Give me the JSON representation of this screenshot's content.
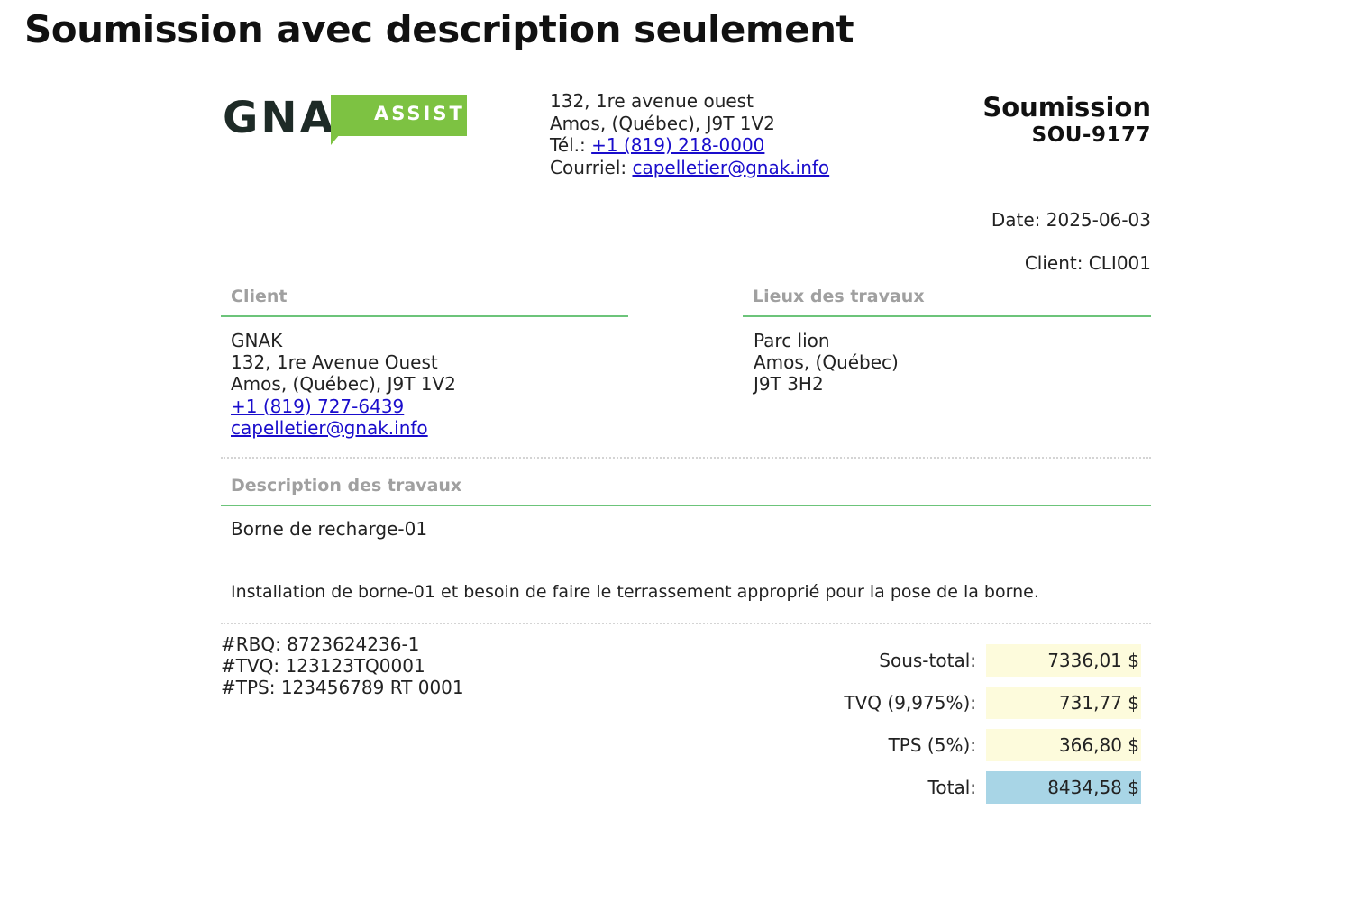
{
  "page_heading": "Soumission avec description seulement",
  "logo": {
    "brand": "GNAK",
    "badge_text": "ASSIST",
    "brand_color": "#1e2b27",
    "badge_color": "#7dc242"
  },
  "company": {
    "address_line1": "132, 1re avenue ouest",
    "address_line2": "Amos, (Québec), J9T 1V2",
    "phone_label": "Tél.: ",
    "phone": "+1 (819) 218-0000",
    "email_label": "Courriel: ",
    "email": "capelletier@gnak.info"
  },
  "document": {
    "title": "Soumission",
    "number": "SOU-9177",
    "date": "Date: 2025-06-03",
    "client_code": "Client: CLI001"
  },
  "client_section": {
    "heading": "Client",
    "name": "GNAK",
    "address_line1": "132, 1re Avenue Ouest",
    "address_line2": "Amos, (Québec), J9T 1V2",
    "phone": "+1 (819) 727-6439",
    "email": "capelletier@gnak.info"
  },
  "work_location": {
    "heading": "Lieux des travaux",
    "line1": "Parc lion",
    "line2": "Amos, (Québec)",
    "line3": "J9T 3H2"
  },
  "description": {
    "heading": "Description des travaux",
    "title": "Borne de recharge-01",
    "text": "Installation de borne-01 et besoin de faire le terrassement approprié pour la pose de la borne."
  },
  "tax_ids": {
    "rbq": "#RBQ: 8723624236-1",
    "tvq": "#TVQ: 123123TQ0001",
    "tps": "#TPS: 123456789 RT 0001"
  },
  "totals": [
    {
      "label": "Sous-total:",
      "value": "7336,01 $",
      "color": "#fdfbdc"
    },
    {
      "label": "TVQ (9,975%):",
      "value": "731,77 $",
      "color": "#fdfbdc"
    },
    {
      "label": "TPS (5%):",
      "value": "366,80 $",
      "color": "#fdfbdc"
    },
    {
      "label": "Total:",
      "value": "8434,58 $",
      "color": "#a8d5e6"
    }
  ],
  "colors": {
    "section_rule": "#6cc47a",
    "link": "#1a0dcc",
    "section_heading": "#a0a0a0"
  }
}
